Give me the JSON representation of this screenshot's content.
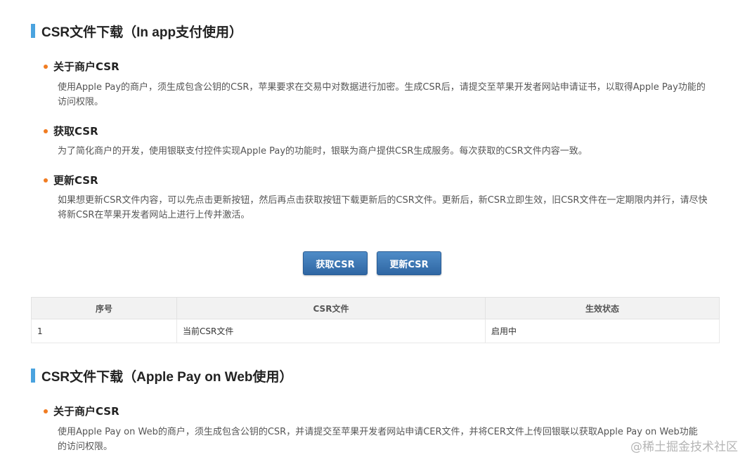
{
  "section1": {
    "title": "CSR文件下载（In app支付使用）",
    "items": [
      {
        "heading": "关于商户CSR",
        "text": "使用Apple Pay的商户，须生成包含公钥的CSR，苹果要求在交易中对数据进行加密。生成CSR后，请提交至苹果开发者网站申请证书，以取得Apple Pay功能的访问权限。"
      },
      {
        "heading": "获取CSR",
        "text": "为了简化商户的开发，使用银联支付控件实现Apple Pay的功能时，银联为商户提供CSR生成服务。每次获取的CSR文件内容一致。"
      },
      {
        "heading": "更新CSR",
        "text": "如果想更新CSR文件内容，可以先点击更新按钮，然后再点击获取按钮下载更新后的CSR文件。更新后，新CSR立即生效，旧CSR文件在一定期限内并行，请尽快将新CSR在苹果开发者网站上进行上传并激活。"
      }
    ],
    "buttons": {
      "get": "获取CSR",
      "update": "更新CSR"
    },
    "table": {
      "headers": [
        "序号",
        "CSR文件",
        "生效状态"
      ],
      "rows": [
        [
          "1",
          "当前CSR文件",
          "启用中"
        ]
      ]
    }
  },
  "section2": {
    "title": "CSR文件下载（Apple Pay on Web使用）",
    "items": [
      {
        "heading": "关于商户CSR",
        "text": "使用Apple Pay on Web的商户，须生成包含公钥的CSR，并请提交至苹果开发者网站申请CER文件，并将CER文件上传回银联以获取Apple Pay on Web功能的访问权限。"
      }
    ]
  },
  "watermark": "@稀土掘金技术社区",
  "colors": {
    "accent_bar": "#4aa3df",
    "bullet": "#f07c22",
    "button": "#3a75b3"
  }
}
